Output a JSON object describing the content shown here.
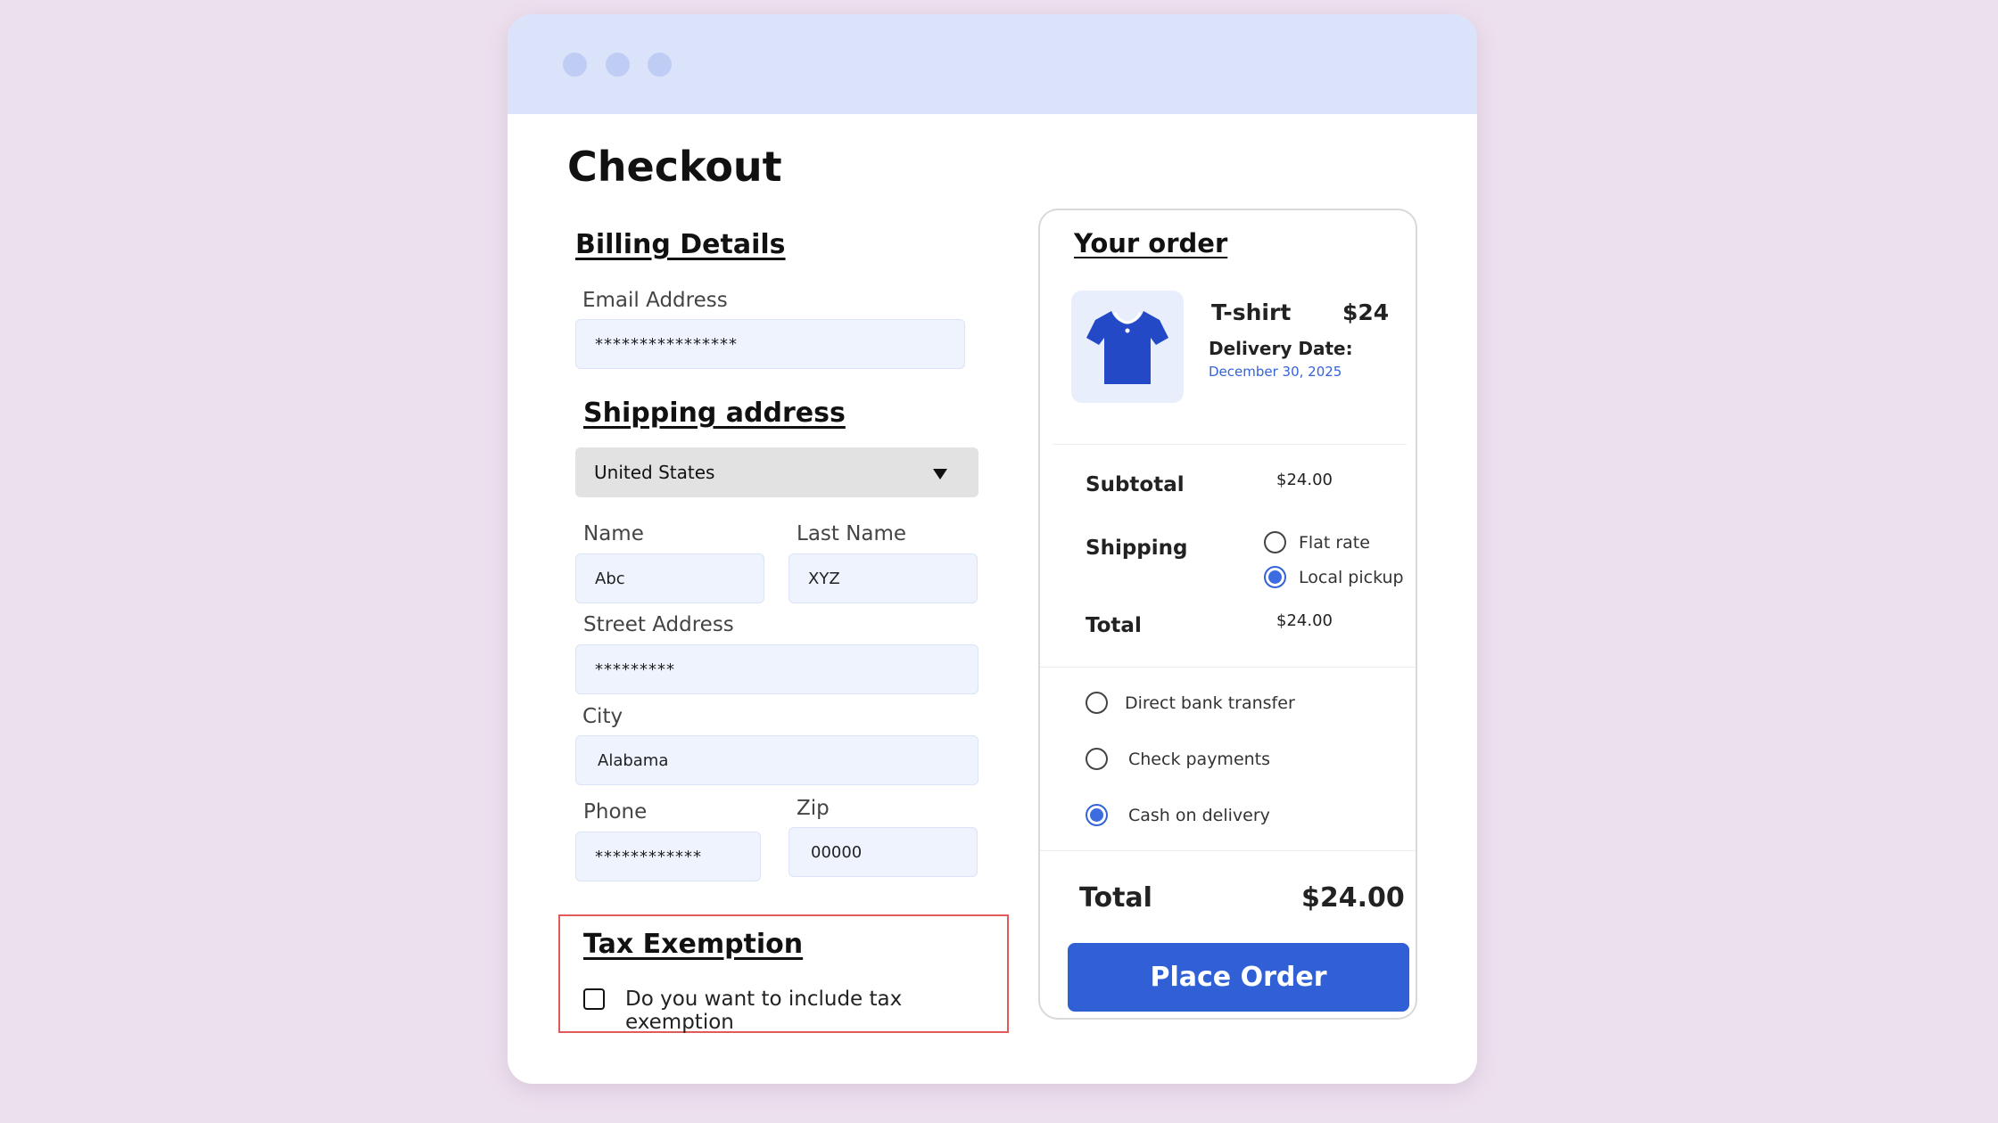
{
  "page": {
    "title": "Checkout"
  },
  "billing": {
    "title": "Billing Details",
    "email_label": "Email Address",
    "email_value": "****************"
  },
  "shipping_address": {
    "title": "Shipping address",
    "country": "United States",
    "name_label": "Name",
    "name_value": "Abc",
    "last_name_label": "Last Name",
    "last_name_value": "XYZ",
    "street_label": "Street Address",
    "street_value": "*********",
    "city_label": "City",
    "city_value": "Alabama",
    "phone_label": "Phone",
    "phone_value": "************",
    "zip_label": "Zip",
    "zip_value": "00000"
  },
  "tax": {
    "title": "Tax Exemption",
    "checkbox_label": "Do you want to include tax exemption",
    "checked": false
  },
  "order": {
    "title": "Your order",
    "product_name": "T-shirt",
    "product_price": "$24",
    "product_icon": "tshirt-icon",
    "delivery_label": "Delivery Date:",
    "delivery_date": "December 30, 2025",
    "subtotal_label": "Subtotal",
    "subtotal_value": "$24.00",
    "shipping_label": "Shipping",
    "shipping_options": [
      {
        "label": "Flat rate",
        "selected": false
      },
      {
        "label": "Local pickup",
        "selected": true
      }
    ],
    "total_label": "Total",
    "total_value": "$24.00",
    "payment_options": [
      {
        "label": "Direct bank transfer",
        "selected": false
      },
      {
        "label": "Check payments",
        "selected": false
      },
      {
        "label": "Cash on delivery",
        "selected": true
      }
    ],
    "grand_total_label": "Total",
    "grand_total_value": "$24.00",
    "place_order_label": "Place Order"
  },
  "colors": {
    "accent": "#3160d6",
    "background": "#ede0ee",
    "titlebar": "#dbe3fb",
    "tax_box_border": "#e25b5b"
  }
}
